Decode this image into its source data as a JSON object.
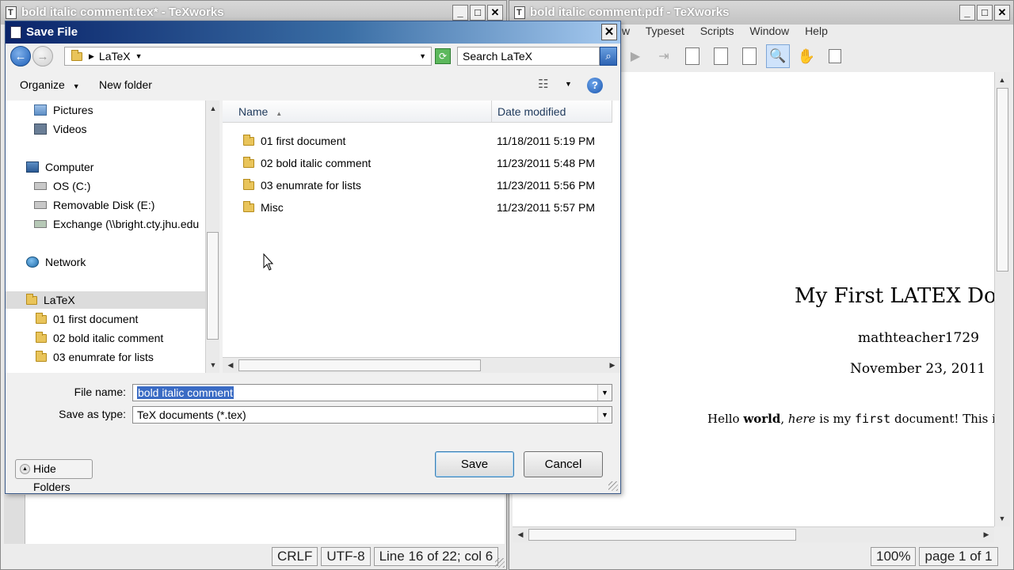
{
  "editor_window": {
    "title": "bold italic comment.tex* - TeXworks",
    "status": {
      "line_endings": "CRLF",
      "encoding": "UTF-8",
      "position": "Line 16 of 22; col 6"
    }
  },
  "pdf_window": {
    "title": "bold italic comment.pdf - TeXworks",
    "menu": [
      "w",
      "Typeset",
      "Scripts",
      "Window",
      "Help"
    ],
    "doc": {
      "title": "My First LATEX Docu",
      "author": "mathteacher1729",
      "date": "November 23, 2011",
      "body_parts": [
        {
          "t": "Hello ",
          "s": "normal"
        },
        {
          "t": "world",
          "s": "bold"
        },
        {
          "t": ", ",
          "s": "normal"
        },
        {
          "t": "here",
          "s": "italic"
        },
        {
          "t": " is my ",
          "s": "normal"
        },
        {
          "t": "first",
          "s": "mono"
        },
        {
          "t": " document! This is",
          "s": "normal"
        }
      ]
    },
    "status": {
      "zoom": "100%",
      "page": "page 1 of 1"
    }
  },
  "dialog": {
    "title": "Save File",
    "close_glyph": "✕",
    "address": {
      "location": "LaTeX"
    },
    "search_placeholder": "Search LaTeX",
    "organize": "Organize",
    "new_folder": "New folder",
    "nav_tree": [
      {
        "label": "Pictures",
        "icon": "pictures-icon",
        "indent": 1
      },
      {
        "label": "Videos",
        "icon": "videos-icon",
        "indent": 1
      },
      {
        "label": "Computer",
        "icon": "computer-icon",
        "indent": 0
      },
      {
        "label": "OS (C:)",
        "icon": "drive-icon",
        "indent": 1
      },
      {
        "label": "Removable Disk (E:)",
        "icon": "removable-disk-icon",
        "indent": 1
      },
      {
        "label": "Exchange (\\\\bright.cty.jhu.edu",
        "icon": "network-drive-icon",
        "indent": 1
      },
      {
        "label": "Network",
        "icon": "network-icon",
        "indent": 0
      },
      {
        "label": "LaTeX",
        "icon": "folder-icon",
        "indent": 0,
        "selected": true
      },
      {
        "label": "01 first document",
        "icon": "folder-icon",
        "indent": 1
      },
      {
        "label": "02 bold italic comment",
        "icon": "folder-icon",
        "indent": 1
      },
      {
        "label": "03 enumrate for lists",
        "icon": "folder-icon",
        "indent": 1
      }
    ],
    "columns": {
      "name": "Name",
      "date": "Date modified"
    },
    "files": [
      {
        "name": "01 first document",
        "date": "11/18/2011 5:19 PM"
      },
      {
        "name": "02 bold italic comment",
        "date": "11/23/2011 5:48 PM"
      },
      {
        "name": "03 enumrate for lists",
        "date": "11/23/2011 5:56 PM"
      },
      {
        "name": "Misc",
        "date": "11/23/2011 5:57 PM"
      }
    ],
    "file_name_label": "File name:",
    "file_name_value": "bold italic comment",
    "save_type_label": "Save as type:",
    "save_type_value": "TeX documents (*.tex)",
    "hide_folders": "Hide Folders",
    "save": "Save",
    "cancel": "Cancel"
  }
}
